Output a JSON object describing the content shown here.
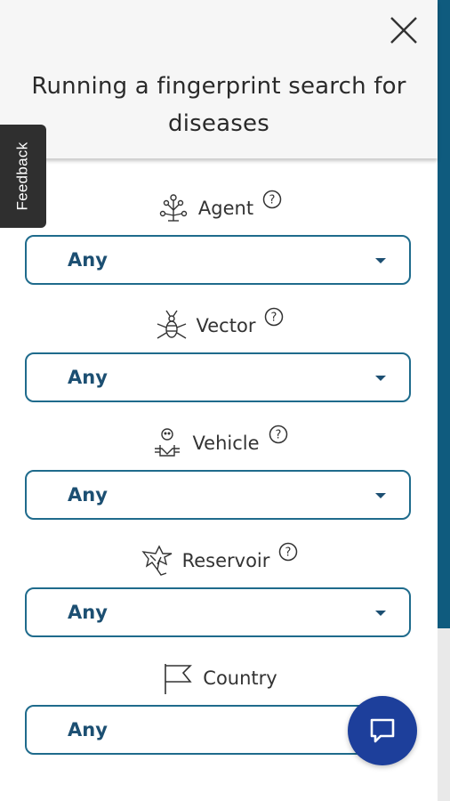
{
  "header": {
    "title": "Running a fingerprint search for diseases",
    "close_icon": "close-icon"
  },
  "feedback": {
    "label": "Feedback"
  },
  "fields": [
    {
      "label": "Agent",
      "icon": "agent-icon",
      "has_help": true,
      "value": "Any"
    },
    {
      "label": "Vector",
      "icon": "mosquito-icon",
      "has_help": true,
      "value": "Any"
    },
    {
      "label": "Vehicle",
      "icon": "vehicle-icon",
      "has_help": true,
      "value": "Any"
    },
    {
      "label": "Reservoir",
      "icon": "reservoir-icon",
      "has_help": true,
      "value": "Any"
    },
    {
      "label": "Country",
      "icon": "flag-icon",
      "has_help": false,
      "value": "Any"
    }
  ],
  "chat": {
    "icon": "chat-icon"
  },
  "colors": {
    "accent": "#1f6b8c",
    "select_text": "#1c4f72",
    "chat_button": "#1d3f9b",
    "scrollbar": "#0f5b7e",
    "feedback_bg": "#2f2f2f"
  }
}
